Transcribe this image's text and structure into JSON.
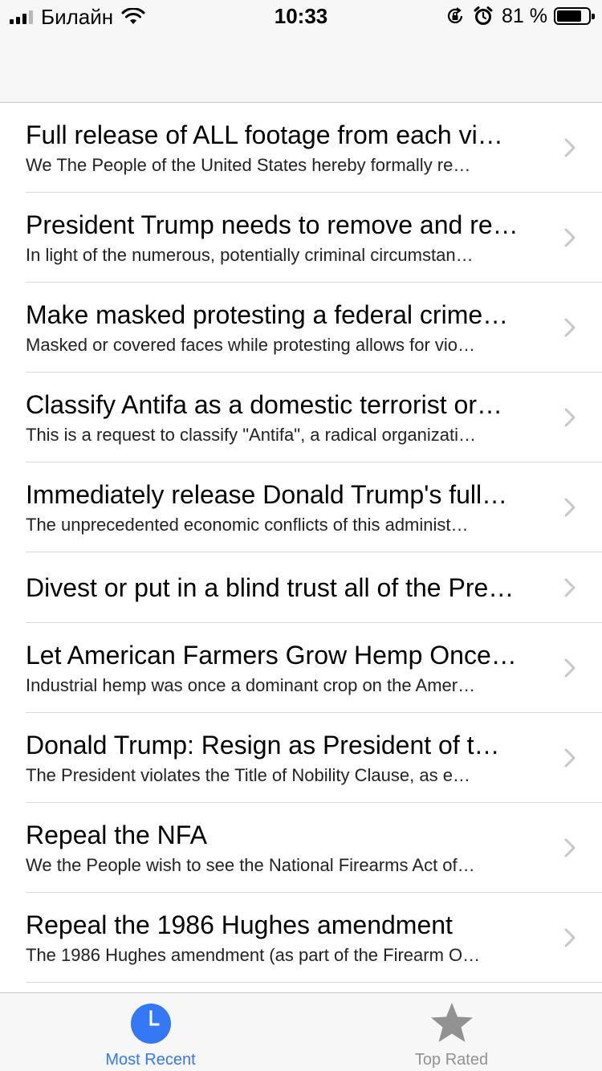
{
  "status_bar": {
    "carrier": "Билайн",
    "time": "10:33",
    "battery_percent": "81 %",
    "battery_level": 0.81
  },
  "list": {
    "items": [
      {
        "title": "Full release of ALL footage from each vi…",
        "subtitle": "We The People of the United States hereby formally re…"
      },
      {
        "title": "President Trump needs to remove and re…",
        "subtitle": "In light of the numerous, potentially criminal circumstan…"
      },
      {
        "title": "Make masked protesting a federal crime…",
        "subtitle": "Masked or covered faces while protesting allows for vio…"
      },
      {
        "title": "Classify Antifa as a domestic terrorist or…",
        "subtitle": "This is a request to classify \"Antifa\", a radical organizati…"
      },
      {
        "title": "Immediately release Donald Trump's full…",
        "subtitle": "The unprecedented economic conflicts of this administ…"
      },
      {
        "title": "Divest or put in a blind trust all of the Pre…",
        "subtitle": ""
      },
      {
        "title": "Let American Farmers Grow Hemp Once…",
        "subtitle": "Industrial hemp was once a dominant crop on the Amer…"
      },
      {
        "title": "Donald Trump:  Resign as President of t…",
        "subtitle": "The President violates the Title of Nobility Clause, as e…"
      },
      {
        "title": "Repeal the NFA",
        "subtitle": "We the People wish to see the National Firearms Act of…"
      },
      {
        "title": "Repeal the 1986 Hughes amendment",
        "subtitle": "The 1986 Hughes amendment (as part of the Firearm O…"
      }
    ]
  },
  "tab_bar": {
    "tabs": [
      {
        "label": "Most Recent",
        "icon": "clock-icon",
        "active": true
      },
      {
        "label": "Top Rated",
        "icon": "star-icon",
        "active": false
      }
    ]
  },
  "colors": {
    "accent": "#3478f6",
    "inactive": "#929292",
    "bar_background": "#f7f7f7",
    "separator": "#d8d8dc"
  }
}
